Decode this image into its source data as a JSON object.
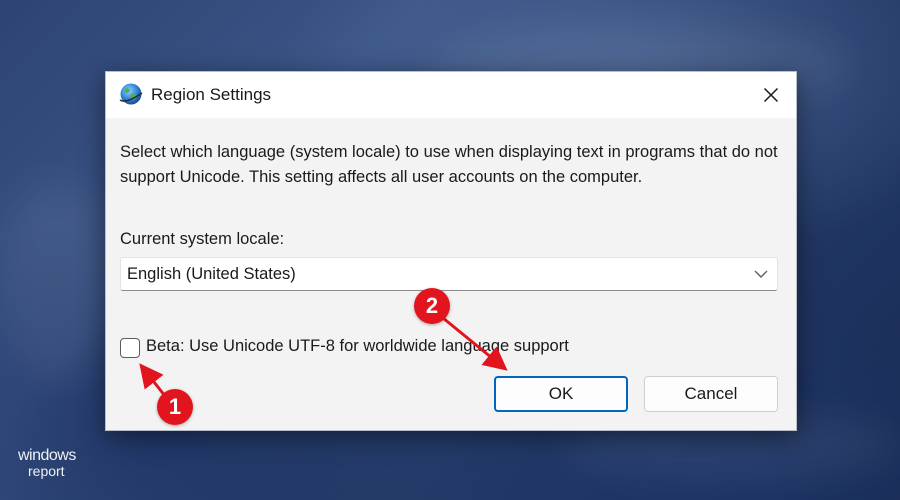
{
  "dialog": {
    "title": "Region Settings",
    "icon": "globe-icon",
    "description": "Select which language (system locale) to use when displaying text in programs that do not support Unicode. This setting affects all user accounts on the computer.",
    "locale_label": "Current system locale:",
    "locale_value": "English (United States)",
    "beta_label": "Beta: Use Unicode UTF-8 for worldwide language support",
    "beta_checked": false,
    "ok_label": "OK",
    "cancel_label": "Cancel",
    "close_icon": "close-icon"
  },
  "annotations": [
    {
      "label": "1",
      "color": "#e2141d"
    },
    {
      "label": "2",
      "color": "#e2141d"
    }
  ],
  "watermark": {
    "line1": "windows",
    "line2": "report"
  },
  "colors": {
    "accent": "#0067c0",
    "badge": "#e2141d",
    "dialog_bg": "#f3f3f3"
  }
}
